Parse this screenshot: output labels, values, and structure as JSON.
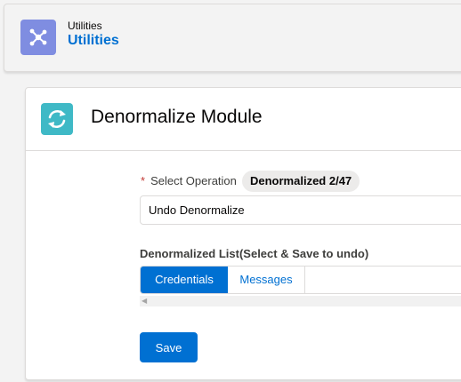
{
  "header": {
    "eyebrow": "Utilities",
    "title": "Utilities",
    "icon": "network-nodes-icon"
  },
  "module": {
    "title": "Denormalize Module",
    "icon": "refresh-sync-icon"
  },
  "operation": {
    "required_marker": "*",
    "label": "Select Operation",
    "badge": "Denormalized 2/47",
    "selected_value": "Undo Denormalize"
  },
  "list": {
    "label": "Denormalized List(Select & Save to undo)",
    "tabs": [
      {
        "label": "Credentials",
        "active": true
      },
      {
        "label": "Messages",
        "active": false
      }
    ]
  },
  "actions": {
    "save_label": "Save"
  },
  "colors": {
    "brand": "#0070d2",
    "app_icon_bg": "#7f8de1",
    "module_icon_bg": "#3fb9c6",
    "required": "#c23934"
  }
}
